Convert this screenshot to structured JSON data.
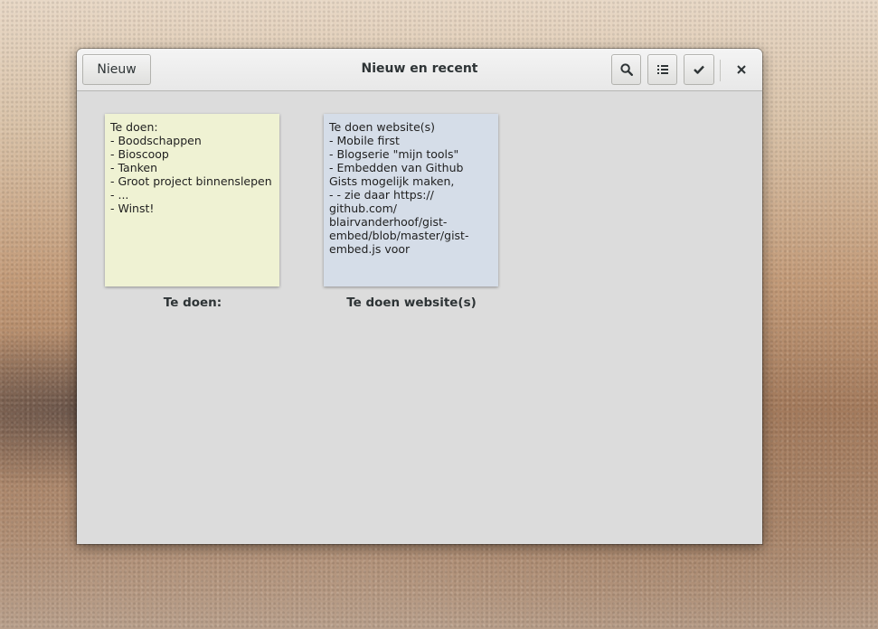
{
  "window": {
    "title": "Nieuw en recent"
  },
  "headerbar": {
    "new_label": "Nieuw",
    "icons": {
      "search": "search-icon",
      "list": "list-view-icon",
      "select": "checkmark-icon",
      "close": "close-icon"
    }
  },
  "notes": [
    {
      "text": "Te doen:\n- Boodschappen\n- Bioscoop\n- Tanken\n- Groot project binnenslepen\n- ...\n- Winst!",
      "title": "Te doen:",
      "color": "#eff2d3"
    },
    {
      "text": "Te doen website(s)\n- Mobile first\n- Blogserie \"mijn tools\"\n- Embedden van Github Gists mogelijk maken,\n- - zie daar https:// github.com/ blairvanderhoof/gist-embed/blob/master/gist-embed.js voor",
      "title": "Te doen website(s)",
      "color": "#d5dde8"
    }
  ]
}
